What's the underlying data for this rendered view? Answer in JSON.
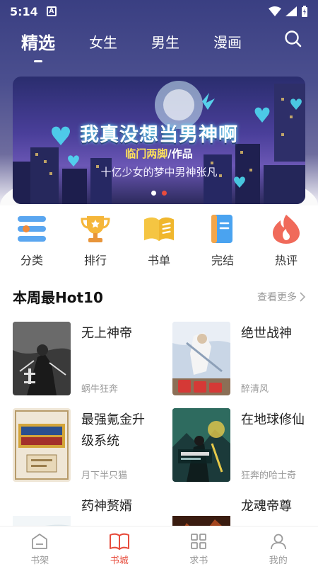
{
  "status": {
    "time": "5:14",
    "a_badge": "A"
  },
  "tabs": [
    {
      "label": "精选",
      "active": true
    },
    {
      "label": "女生"
    },
    {
      "label": "男生"
    },
    {
      "label": "漫画"
    }
  ],
  "banner": {
    "title": "我真没想当男神啊",
    "author": "临门两脚",
    "author_suffix": "/作品",
    "subtitle": "十亿少女的梦中男神张凡",
    "slide_count": 2,
    "current_slide": 2
  },
  "categories": [
    {
      "label": "分类",
      "icon": "category-list-icon"
    },
    {
      "label": "排行",
      "icon": "trophy-icon"
    },
    {
      "label": "书单",
      "icon": "open-book-icon"
    },
    {
      "label": "完结",
      "icon": "finished-book-icon"
    },
    {
      "label": "热评",
      "icon": "flame-icon"
    }
  ],
  "section": {
    "title": "本周最Hot10",
    "more": "查看更多"
  },
  "books": [
    {
      "title": "无上神帝",
      "author": "蜗牛狂奔"
    },
    {
      "title": "绝世战神",
      "author": "醉清风"
    },
    {
      "title": "最强氪金升级系统",
      "author": "月下半只猫"
    },
    {
      "title": "在地球修仙",
      "author": "狂奔的哈士奇"
    },
    {
      "title": "药神赘婿",
      "author": ""
    },
    {
      "title": "龙魂帝尊",
      "author": ""
    }
  ],
  "bottom_nav": [
    {
      "label": "书架",
      "icon": "bookshelf-icon"
    },
    {
      "label": "书城",
      "icon": "bookstore-icon",
      "active": true
    },
    {
      "label": "求书",
      "icon": "request-grid-icon"
    },
    {
      "label": "我的",
      "icon": "profile-icon"
    }
  ],
  "colors": {
    "accent": "#e74c3c",
    "header": "#3a3f82"
  }
}
